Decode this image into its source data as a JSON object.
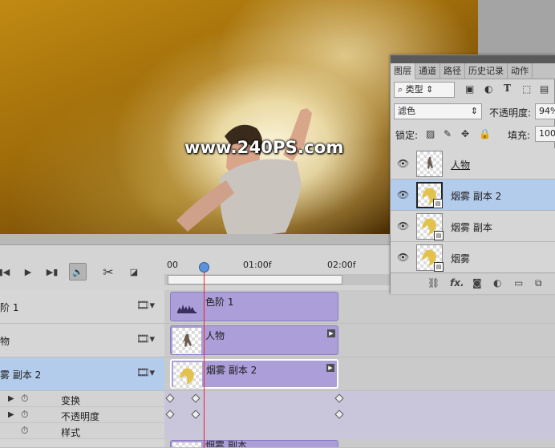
{
  "canvas": {
    "watermark": "www.240PS.com"
  },
  "timeline": {
    "ruler": {
      "t0": "00",
      "t1": "01:00f",
      "t2": "02:00f"
    },
    "controls": {
      "prev_icon": "skip-back-icon",
      "play_icon": "play-icon",
      "next_icon": "skip-forward-icon",
      "audio_icon": "speaker-icon",
      "split_icon": "scissors-icon",
      "transition_icon": "transition-icon"
    },
    "layers": [
      {
        "name": "阶 1",
        "clip": "色阶 1"
      },
      {
        "name": "物",
        "clip": "人物"
      },
      {
        "name": "雾 副本 2",
        "clip": "烟雾 副本 2"
      }
    ],
    "properties": [
      "变换",
      "不透明度",
      "样式"
    ],
    "partial_clip": "烟雾 副本"
  },
  "layers_panel": {
    "tabs": [
      "图层",
      "通道",
      "路径",
      "历史记录",
      "动作"
    ],
    "filter_label": "类型",
    "blend_mode": "滤色",
    "opacity_label": "不透明度:",
    "opacity_value": "94%",
    "lock_label": "锁定:",
    "fill_label": "填充:",
    "fill_value": "100%",
    "layers": [
      {
        "name": "人物"
      },
      {
        "name": "烟雾 副本 2"
      },
      {
        "name": "烟雾 副本"
      },
      {
        "name": "烟雾"
      }
    ]
  },
  "colors": {
    "selected_row": "#b4ccec",
    "clip_fill": "#ab9ed9",
    "playhead": "#e8252a"
  }
}
